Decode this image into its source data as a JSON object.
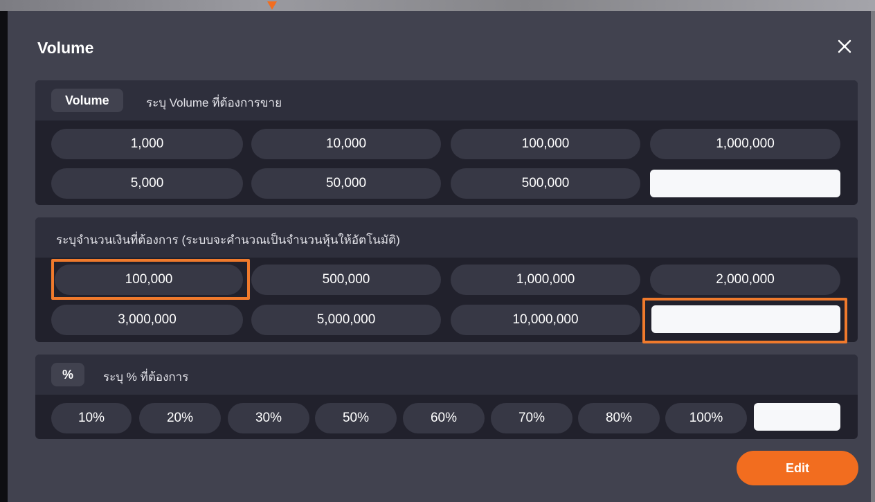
{
  "dialog": {
    "title": "Volume",
    "close_icon": "close-icon"
  },
  "volume_section": {
    "chip_label": "Volume",
    "description": "ระบุ Volume ที่ต้องการขาย",
    "options": [
      "1,000",
      "10,000",
      "100,000",
      "1,000,000",
      "5,000",
      "50,000",
      "500,000"
    ],
    "custom_input": {
      "value": "",
      "placeholder": ""
    }
  },
  "amount_section": {
    "description": "ระบุจำนวนเงินที่ต้องการ (ระบบจะคำนวณเป็นจำนวนหุ้นให้อัตโนมัติ)",
    "options": [
      "100,000",
      "500,000",
      "1,000,000",
      "2,000,000",
      "3,000,000",
      "5,000,000",
      "10,000,000"
    ],
    "custom_input": {
      "value": "",
      "placeholder": ""
    }
  },
  "percent_section": {
    "chip_label": "%",
    "description": "ระบุ % ที่ต้องการ",
    "options": [
      "10%",
      "20%",
      "30%",
      "50%",
      "60%",
      "70%",
      "80%",
      "100%"
    ],
    "custom_input": {
      "value": "",
      "placeholder": ""
    }
  },
  "footer": {
    "edit_label": "Edit"
  },
  "colors": {
    "accent": "#f26d1f",
    "highlight": "#f07a2c",
    "dialog_bg": "#41424f",
    "panel_bg": "#21212c",
    "option_bg": "#373845"
  }
}
